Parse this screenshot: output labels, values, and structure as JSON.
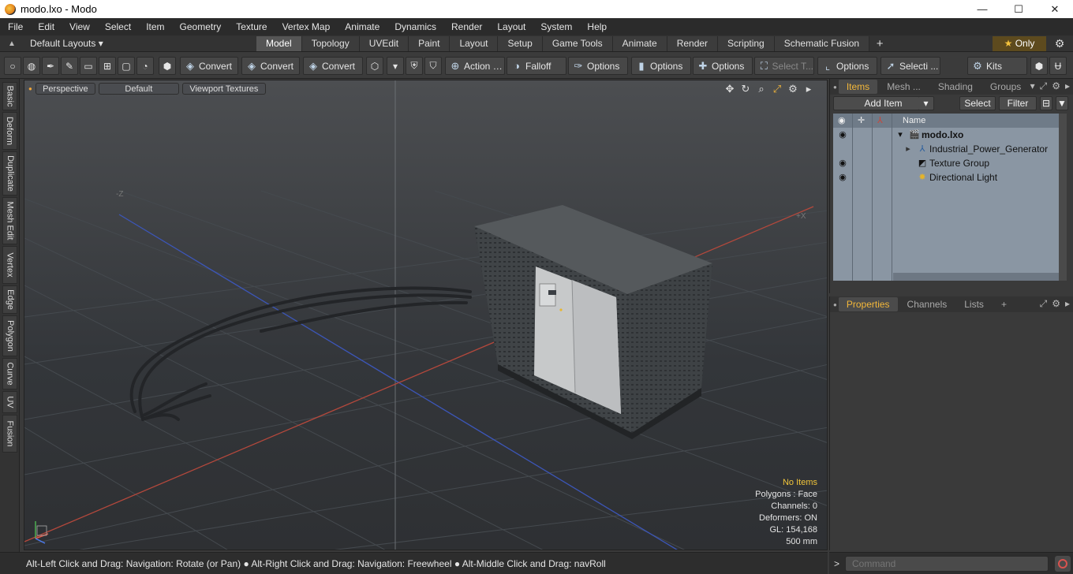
{
  "titlebar": {
    "title": "modo.lxo - Modo",
    "min": "—",
    "max": "☐",
    "close": "✕"
  },
  "menu": [
    "File",
    "Edit",
    "View",
    "Select",
    "Item",
    "Geometry",
    "Texture",
    "Vertex Map",
    "Animate",
    "Dynamics",
    "Render",
    "Layout",
    "System",
    "Help"
  ],
  "layouts": {
    "label": "Default Layouts ▾",
    "tabs": [
      "Model",
      "Topology",
      "UVEdit",
      "Paint",
      "Layout",
      "Setup",
      "Game Tools",
      "Animate",
      "Render",
      "Scripting",
      "Schematic Fusion"
    ],
    "active": "Model",
    "add": "+",
    "only": "Only"
  },
  "toolbar": {
    "convert1": "Convert",
    "convert2": "Convert",
    "convert3": "Convert",
    "action": "Action",
    "falloff": "Falloff",
    "options1": "Options",
    "options2": "Options",
    "options3": "Options",
    "select_t": "Select T...",
    "options4": "Options",
    "selecti": "Selecti ...",
    "kits": "Kits"
  },
  "lefttabs": [
    "Basic",
    "Deform",
    "Duplicate",
    "Mesh Edit",
    "Vertex",
    "Edge",
    "Polygon",
    "Curve",
    "UV",
    "Fusion"
  ],
  "viewport": {
    "perspective": "Perspective",
    "default": "Default",
    "textures": "Viewport Textures",
    "axis_neg_z": "-Z",
    "axis_pos_x": "+X",
    "stats": {
      "items": "No Items",
      "polygons": "Polygons : Face",
      "channels": "Channels: 0",
      "deformers": "Deformers: ON",
      "gl": "GL: 154,168",
      "units": "500 mm"
    }
  },
  "items_panel": {
    "tabs": [
      "Items",
      "Mesh ...",
      "Shading",
      "Groups"
    ],
    "add_item": "Add Item",
    "select": "Select",
    "filter": "Filter",
    "col_name": "Name",
    "rows": [
      {
        "label": "modo.lxo"
      },
      {
        "label": "Industrial_Power_Generator"
      },
      {
        "label": "Texture Group"
      },
      {
        "label": "Directional Light"
      }
    ]
  },
  "props_panel": {
    "tabs": [
      "Properties",
      "Channels",
      "Lists"
    ],
    "add": "+"
  },
  "status": {
    "hint": "Alt-Left Click and Drag: Navigation: Rotate (or Pan) ● Alt-Right Click and Drag: Navigation: Freewheel ● Alt-Middle Click and Drag: navRoll"
  },
  "command": {
    "prompt": ">",
    "placeholder": "Command"
  }
}
